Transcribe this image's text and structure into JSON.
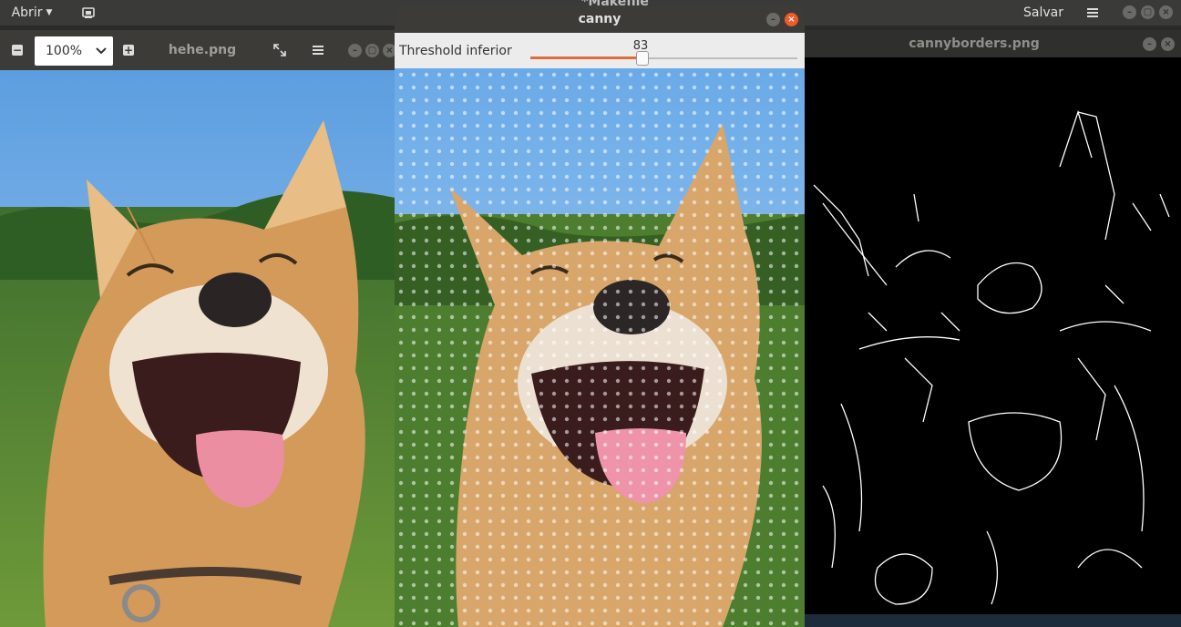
{
  "editor": {
    "title": "*Makefile",
    "open_label": "Abrir",
    "save_label": "Salvar"
  },
  "viewer": {
    "zoom_value": "100%",
    "filename": "hehe.png"
  },
  "canny": {
    "title": "canny",
    "threshold_label": "Threshold inferior",
    "threshold_value": "83",
    "threshold_fraction": 0.42
  },
  "borders": {
    "title": "cannyborders.png"
  },
  "icons": {
    "open_menu": "chevron-down-icon",
    "recent": "recent-documents-icon",
    "menu": "hamburger-menu-icon",
    "minimize": "minimize-icon",
    "maximize": "maximize-icon",
    "close": "close-icon",
    "zoom_out": "minus-icon",
    "zoom_in": "plus-icon",
    "fullscreen": "fullscreen-icon"
  },
  "colors": {
    "slider_fill": "#e06c3c",
    "close_button": "#f15a2b",
    "titlebar": "#3a3a38"
  }
}
